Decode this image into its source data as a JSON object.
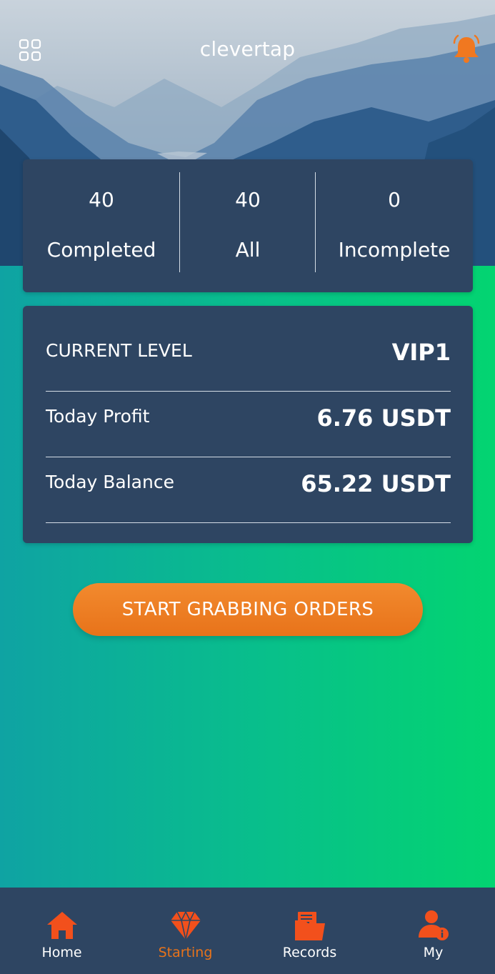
{
  "header": {
    "title": "clevertap",
    "menu_icon": "grid-menu-icon",
    "bell_icon": "bell-icon",
    "bell_color": "#f07820"
  },
  "stats": [
    {
      "value": "40",
      "label": "Completed"
    },
    {
      "value": "40",
      "label": "All"
    },
    {
      "value": "0",
      "label": "Incomplete"
    }
  ],
  "level_card": {
    "rows": [
      {
        "label": "CURRENT LEVEL",
        "value": "VIP1"
      },
      {
        "label": "Today Profit",
        "value": "6.76 USDT"
      },
      {
        "label": "Today Balance",
        "value": "65.22 USDT"
      }
    ]
  },
  "cta": {
    "label": "START GRABBING ORDERS"
  },
  "nav": {
    "items": [
      {
        "label": "Home",
        "icon": "home-icon"
      },
      {
        "label": "Starting",
        "icon": "diamond-icon"
      },
      {
        "label": "Records",
        "icon": "folder-icon"
      },
      {
        "label": "My",
        "icon": "user-info-icon"
      }
    ],
    "active_index": 1
  },
  "colors": {
    "accent": "#f07820",
    "card": "#2e4562",
    "bg_left": "#0fa3a3",
    "bg_right": "#03d471"
  }
}
